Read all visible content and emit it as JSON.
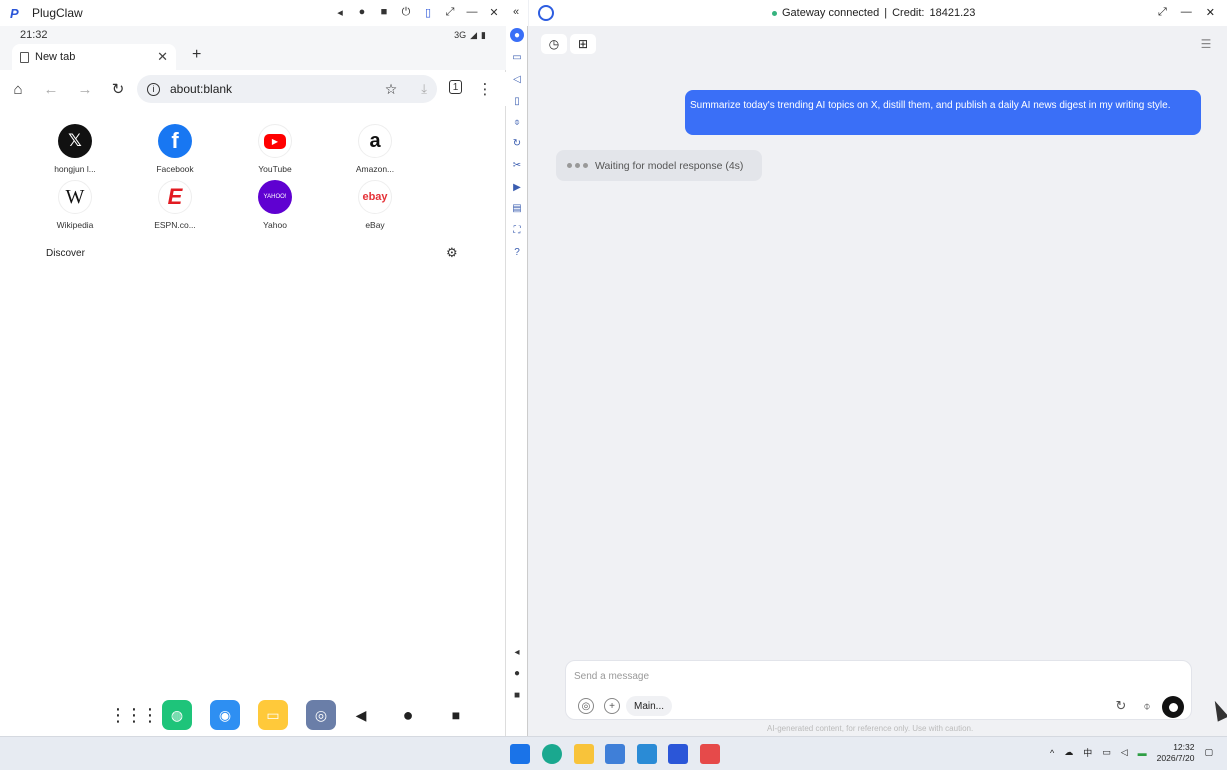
{
  "emulator": {
    "title": "PlugClaw",
    "status_time": "21:32",
    "status_network": "3G",
    "tab_title": "New tab",
    "url": "about:blank",
    "shortcuts": [
      {
        "label": "hongjun l...",
        "icon": "x-logo-icon",
        "glyph": "𝕏",
        "bg": "#111111"
      },
      {
        "label": "Facebook",
        "icon": "facebook-icon",
        "glyph": "f",
        "bg": "#1877f2"
      },
      {
        "label": "YouTube",
        "icon": "youtube-icon",
        "glyph": "▶",
        "bg": "#ff0000"
      },
      {
        "label": "Amazon...",
        "icon": "amazon-icon",
        "glyph": "a",
        "bg": "#ffffff"
      },
      {
        "label": "Wikipedia",
        "icon": "wikipedia-icon",
        "glyph": "W",
        "bg": "#ffffff"
      },
      {
        "label": "ESPN.co...",
        "icon": "espn-icon",
        "glyph": "E",
        "bg": "#e21b22"
      },
      {
        "label": "Yahoo",
        "icon": "yahoo-icon",
        "glyph": "YAHOO!",
        "bg": "#5f01d1"
      },
      {
        "label": "eBay",
        "icon": "ebay-icon",
        "glyph": "ebay",
        "bg": "#ffffff"
      }
    ],
    "discover_label": "Discover"
  },
  "chat": {
    "gateway_status": "Gateway connected",
    "credit_label": "Credit:",
    "credit_value": "18421.23",
    "user_message": "Summarize today's trending AI topics on X, distill them, and publish a daily AI news digest in my writing style.",
    "waiting_text": "Waiting for model response (4s)",
    "composer_placeholder": "Send a message",
    "model_label": "Main...",
    "disclaimer": "AI-generated content, for reference only. Use with caution."
  },
  "taskbar": {
    "ime": "中",
    "time": "12:32",
    "date": "2026/7/20"
  },
  "colors": {
    "accent": "#3a6ff7",
    "status_green": "#36b37e"
  }
}
